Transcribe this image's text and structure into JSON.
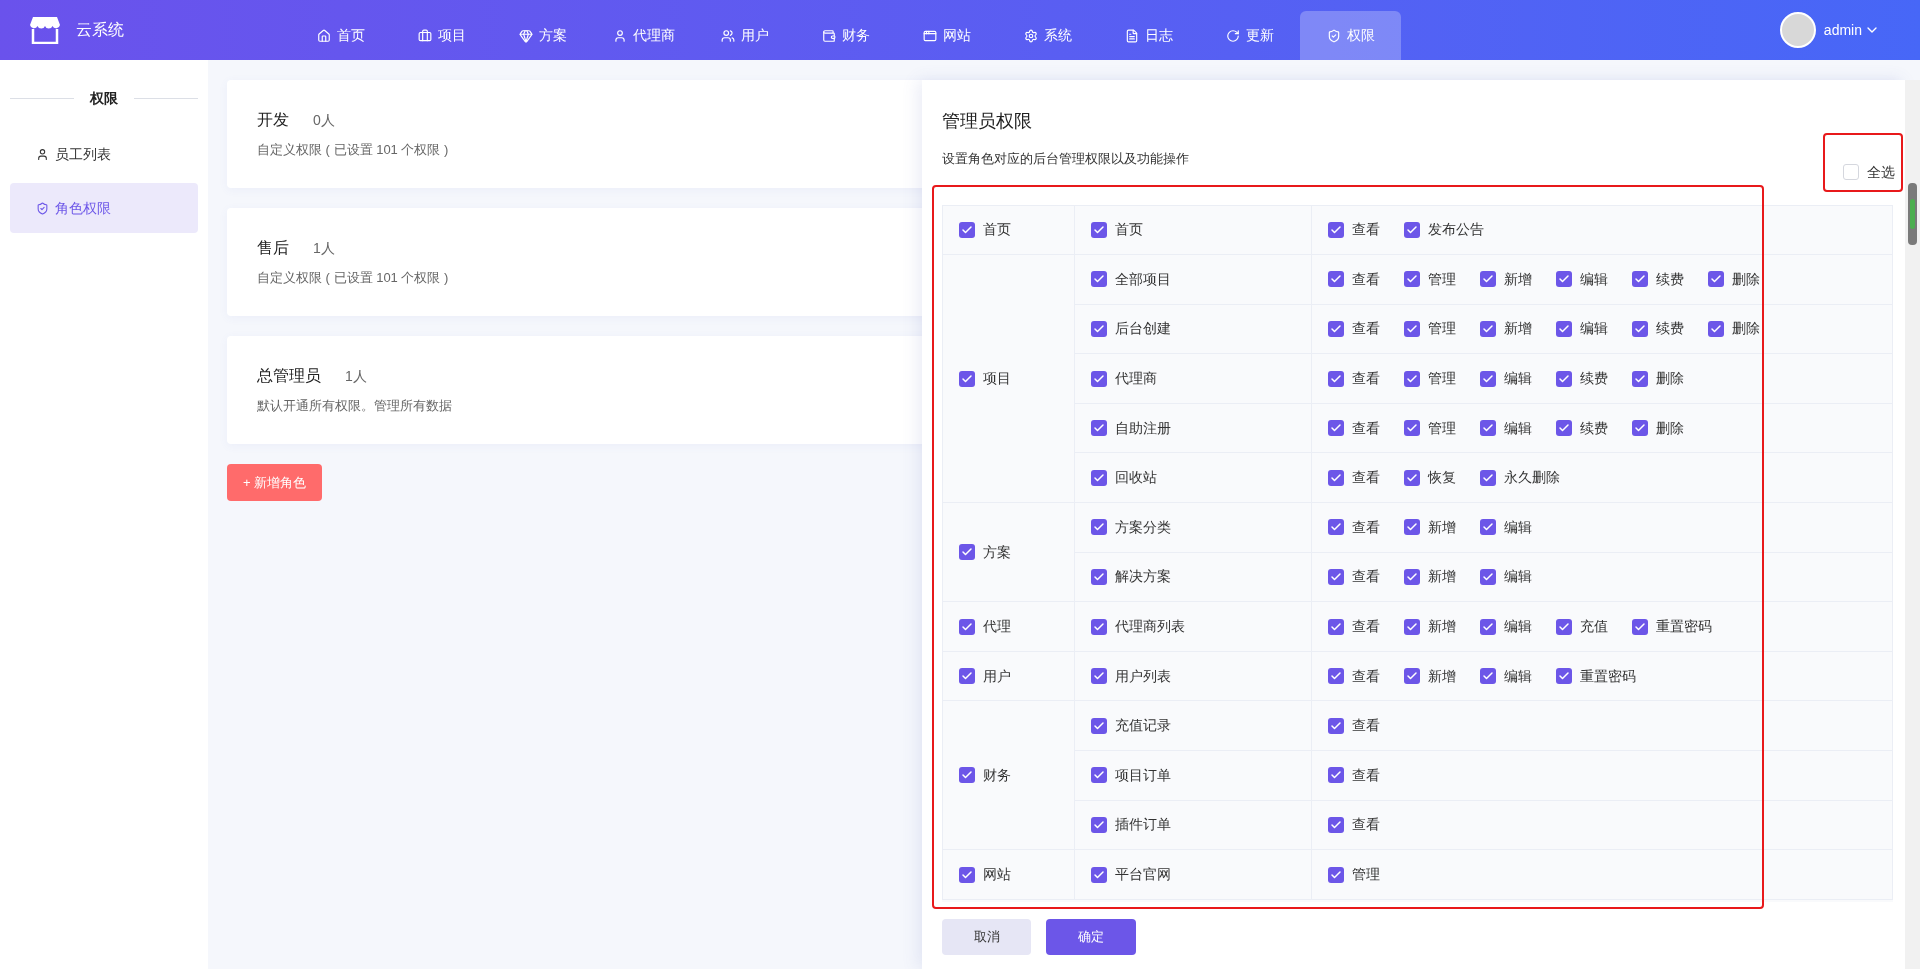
{
  "brand": {
    "name": "云系统"
  },
  "nav": [
    {
      "label": "首页",
      "selected": false
    },
    {
      "label": "项目",
      "selected": false
    },
    {
      "label": "方案",
      "selected": false
    },
    {
      "label": "代理商",
      "selected": false
    },
    {
      "label": "用户",
      "selected": false
    },
    {
      "label": "财务",
      "selected": false
    },
    {
      "label": "网站",
      "selected": false
    },
    {
      "label": "系统",
      "selected": false
    },
    {
      "label": "日志",
      "selected": false
    },
    {
      "label": "更新",
      "selected": false
    },
    {
      "label": "权限",
      "selected": true
    }
  ],
  "user": {
    "name": "admin"
  },
  "sidebar": {
    "title": "权限",
    "items": [
      {
        "label": "员工列表",
        "selected": false
      },
      {
        "label": "角色权限",
        "selected": true
      }
    ]
  },
  "roles": [
    {
      "name": "开发",
      "count": "0人",
      "description": "自定义权限 ( 已设置 101 个权限 )"
    },
    {
      "name": "售后",
      "count": "1人",
      "description": "自定义权限 ( 已设置 101 个权限 )"
    },
    {
      "name": "总管理员",
      "count": "1人",
      "description": "默认开通所有权限。管理所有数据"
    }
  ],
  "add_role_button": "+ 新增角色",
  "panel": {
    "title": "管理员权限",
    "subtitle": "设置角色对应的后台管理权限以及功能操作",
    "select_all": {
      "label": "全选",
      "checked": false
    },
    "groups": [
      {
        "label": "首页",
        "checked": true,
        "pages": [
          {
            "label": "首页",
            "checked": true,
            "actions": [
              {
                "label": "查看",
                "checked": true
              },
              {
                "label": "发布公告",
                "checked": true
              }
            ]
          }
        ]
      },
      {
        "label": "项目",
        "checked": true,
        "pages": [
          {
            "label": "全部项目",
            "checked": true,
            "actions": [
              {
                "label": "查看",
                "checked": true
              },
              {
                "label": "管理",
                "checked": true
              },
              {
                "label": "新增",
                "checked": true
              },
              {
                "label": "编辑",
                "checked": true
              },
              {
                "label": "续费",
                "checked": true
              },
              {
                "label": "删除",
                "checked": true
              }
            ]
          },
          {
            "label": "后台创建",
            "checked": true,
            "actions": [
              {
                "label": "查看",
                "checked": true
              },
              {
                "label": "管理",
                "checked": true
              },
              {
                "label": "新增",
                "checked": true
              },
              {
                "label": "编辑",
                "checked": true
              },
              {
                "label": "续费",
                "checked": true
              },
              {
                "label": "删除",
                "checked": true
              }
            ]
          },
          {
            "label": "代理商",
            "checked": true,
            "actions": [
              {
                "label": "查看",
                "checked": true
              },
              {
                "label": "管理",
                "checked": true
              },
              {
                "label": "编辑",
                "checked": true
              },
              {
                "label": "续费",
                "checked": true
              },
              {
                "label": "删除",
                "checked": true
              }
            ]
          },
          {
            "label": "自助注册",
            "checked": true,
            "actions": [
              {
                "label": "查看",
                "checked": true
              },
              {
                "label": "管理",
                "checked": true
              },
              {
                "label": "编辑",
                "checked": true
              },
              {
                "label": "续费",
                "checked": true
              },
              {
                "label": "删除",
                "checked": true
              }
            ]
          },
          {
            "label": "回收站",
            "checked": true,
            "actions": [
              {
                "label": "查看",
                "checked": true
              },
              {
                "label": "恢复",
                "checked": true
              },
              {
                "label": "永久删除",
                "checked": true
              }
            ]
          }
        ]
      },
      {
        "label": "方案",
        "checked": true,
        "pages": [
          {
            "label": "方案分类",
            "checked": true,
            "actions": [
              {
                "label": "查看",
                "checked": true
              },
              {
                "label": "新增",
                "checked": true
              },
              {
                "label": "编辑",
                "checked": true
              }
            ]
          },
          {
            "label": "解决方案",
            "checked": true,
            "actions": [
              {
                "label": "查看",
                "checked": true
              },
              {
                "label": "新增",
                "checked": true
              },
              {
                "label": "编辑",
                "checked": true
              }
            ]
          }
        ]
      },
      {
        "label": "代理",
        "checked": true,
        "pages": [
          {
            "label": "代理商列表",
            "checked": true,
            "actions": [
              {
                "label": "查看",
                "checked": true
              },
              {
                "label": "新增",
                "checked": true
              },
              {
                "label": "编辑",
                "checked": true
              },
              {
                "label": "充值",
                "checked": true
              },
              {
                "label": "重置密码",
                "checked": true
              }
            ]
          }
        ]
      },
      {
        "label": "用户",
        "checked": true,
        "pages": [
          {
            "label": "用户列表",
            "checked": true,
            "actions": [
              {
                "label": "查看",
                "checked": true
              },
              {
                "label": "新增",
                "checked": true
              },
              {
                "label": "编辑",
                "checked": true
              },
              {
                "label": "重置密码",
                "checked": true
              }
            ]
          }
        ]
      },
      {
        "label": "财务",
        "checked": true,
        "pages": [
          {
            "label": "充值记录",
            "checked": true,
            "actions": [
              {
                "label": "查看",
                "checked": true
              }
            ]
          },
          {
            "label": "项目订单",
            "checked": true,
            "actions": [
              {
                "label": "查看",
                "checked": true
              }
            ]
          },
          {
            "label": "插件订单",
            "checked": true,
            "actions": [
              {
                "label": "查看",
                "checked": true
              }
            ]
          }
        ]
      },
      {
        "label": "网站",
        "checked": true,
        "pages": [
          {
            "label": "平台官网",
            "checked": true,
            "actions": [
              {
                "label": "管理",
                "checked": true
              }
            ]
          }
        ]
      }
    ],
    "cancel_button": "取消",
    "confirm_button": "确定"
  }
}
